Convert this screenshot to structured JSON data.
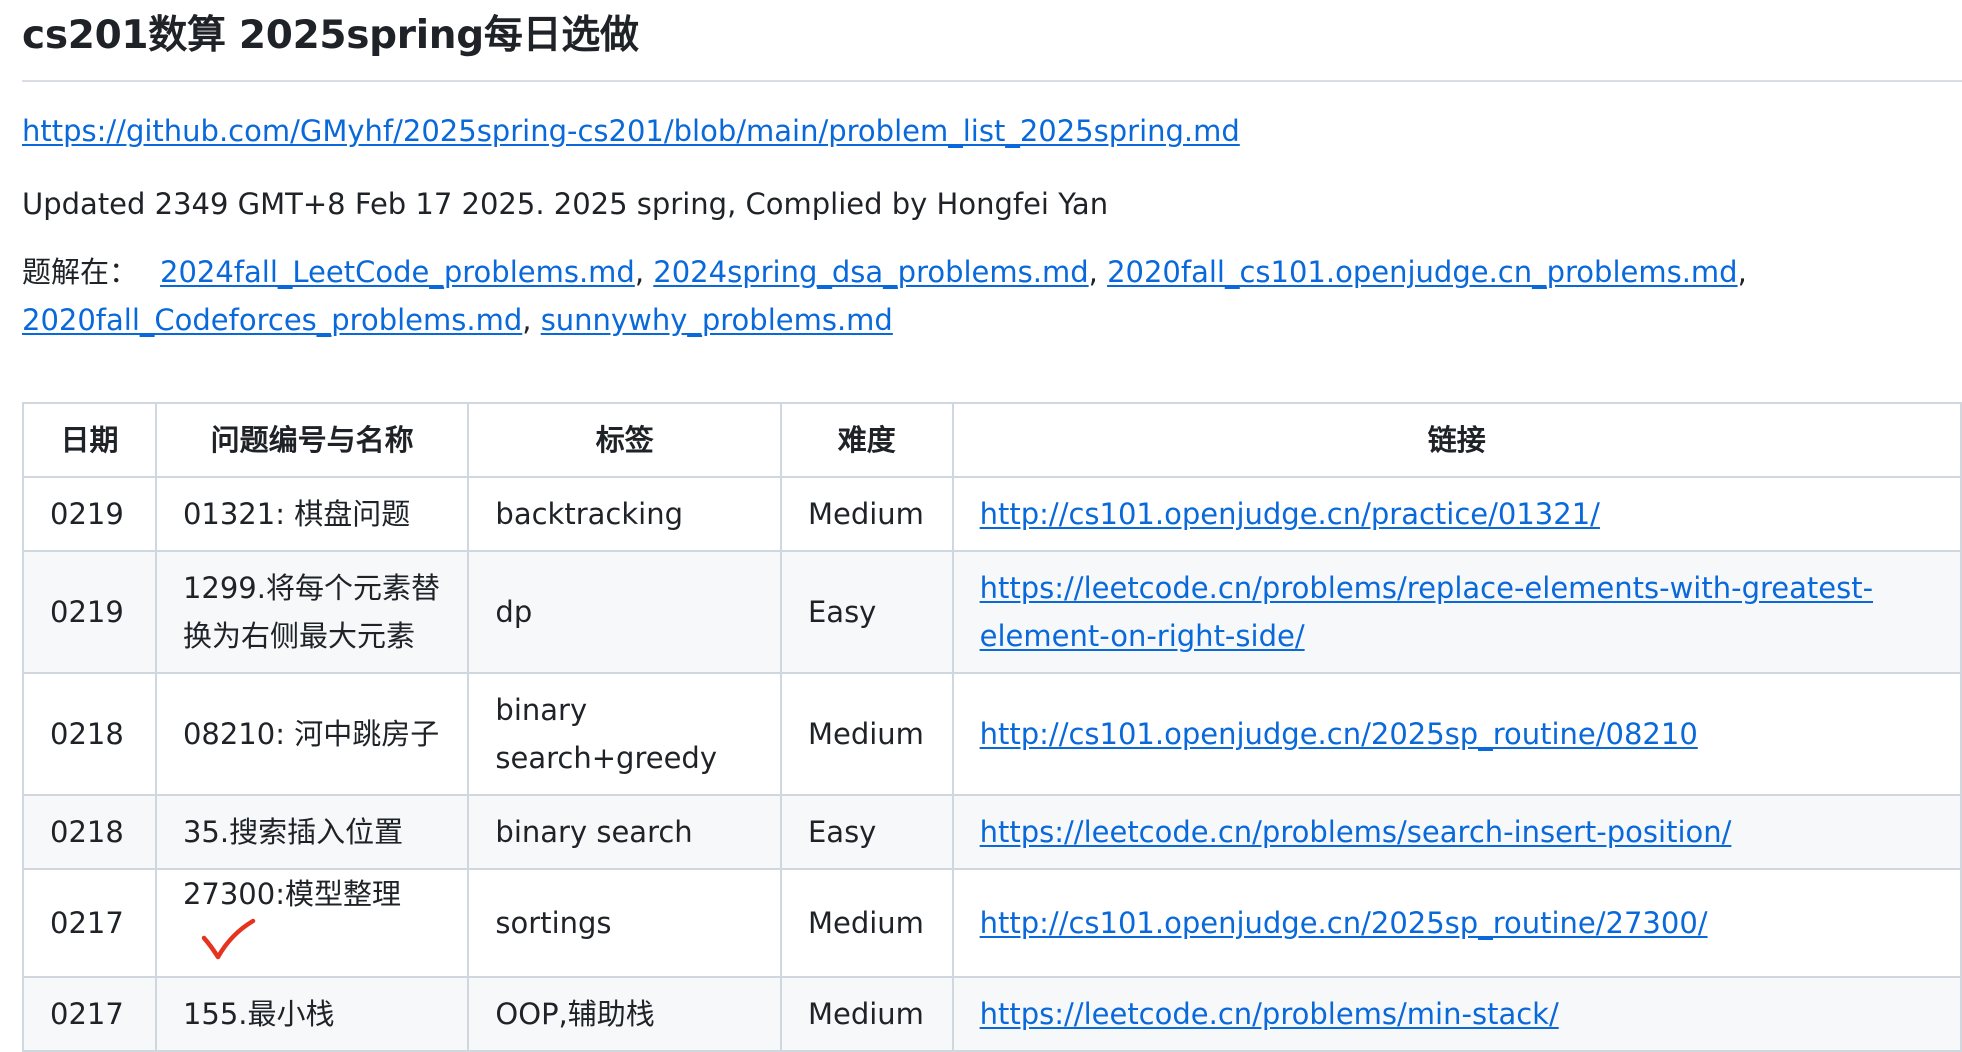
{
  "page": {
    "title": "cs201数算 2025spring每日选做",
    "repo_link": "https://github.com/GMyhf/2025spring-cs201/blob/main/problem_list_2025spring.md",
    "updated_text": "Updated 2349 GMT+8 Feb 17 2025. 2025 spring, Complied by Hongfei Yan",
    "solutions_label": "题解在：",
    "solution_links": [
      "2024fall_LeetCode_problems.md",
      "2024spring_dsa_problems.md",
      "2020fall_cs101.openjudge.cn_problems.md",
      "2020fall_Codeforces_problems.md",
      "sunnywhy_problems.md"
    ],
    "sep": ","
  },
  "table": {
    "headers": [
      "日期",
      "问题编号与名称",
      "标签",
      "难度",
      "链接"
    ],
    "rows": [
      {
        "date": "0219",
        "name": "01321: 棋盘问题",
        "tag": "backtracking",
        "difficulty": "Medium",
        "link": "http://cs101.openjudge.cn/practice/01321/"
      },
      {
        "date": "0219",
        "name": "1299.将每个元素替换为右侧最大元素",
        "tag": "dp",
        "difficulty": "Easy",
        "link": "https://leetcode.cn/problems/replace-elements-with-greatest-element-on-right-side/"
      },
      {
        "date": "0218",
        "name": "08210: 河中跳房子",
        "tag": "binary search+greedy",
        "difficulty": "Medium",
        "link": "http://cs101.openjudge.cn/2025sp_routine/08210"
      },
      {
        "date": "0218",
        "name": "35.搜索插入位置",
        "tag": "binary search",
        "difficulty": "Easy",
        "link": "https://leetcode.cn/problems/search-insert-position/"
      },
      {
        "date": "0217",
        "name": "27300:模型整理",
        "tag": "sortings",
        "difficulty": "Medium",
        "link": "http://cs101.openjudge.cn/2025sp_routine/27300/"
      },
      {
        "date": "0217",
        "name": "155.最小栈",
        "tag": "OOP,辅助栈",
        "difficulty": "Medium",
        "link": "https://leetcode.cn/problems/min-stack/"
      }
    ]
  },
  "annotation": {
    "icon": "red-check-mark-icon",
    "color": "#e5331f"
  }
}
